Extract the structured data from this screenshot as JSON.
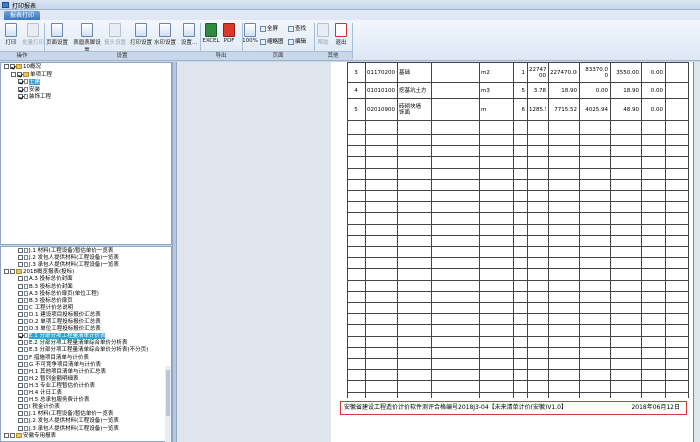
{
  "window": {
    "title": "打印报表"
  },
  "menu": {
    "tab": "报表打印"
  },
  "ribbon": {
    "buttons": [
      {
        "label": "打印",
        "icon": "printer-icon",
        "enabled": true
      },
      {
        "label": "批量打印",
        "icon": "batch-print-icon",
        "enabled": false
      },
      {
        "label": "页面设置",
        "icon": "page-setup-icon",
        "enabled": true
      },
      {
        "label": "表眉表脚设置",
        "icon": "header-footer-icon",
        "enabled": true
      },
      {
        "label": "报头设置",
        "icon": "report-header-icon",
        "enabled": false
      },
      {
        "label": "打印设置",
        "icon": "print-settings-icon",
        "enabled": true
      },
      {
        "label": "水印设置",
        "icon": "watermark-icon",
        "enabled": true
      },
      {
        "label": "设置...",
        "icon": "settings-icon",
        "enabled": true
      },
      {
        "label": "EXCEL",
        "icon": "excel-icon",
        "enabled": true
      },
      {
        "label": "PDF",
        "icon": "pdf-icon",
        "enabled": true
      },
      {
        "label": "100%",
        "icon": "zoom-icon",
        "enabled": true
      },
      {
        "label": "帮助",
        "icon": "help-icon",
        "enabled": false
      },
      {
        "label": "退出",
        "icon": "exit-icon",
        "enabled": true
      }
    ],
    "small": [
      {
        "label": "全屏",
        "icon": "fullscreen-icon"
      },
      {
        "label": "查找",
        "icon": "find-icon"
      },
      {
        "label": "缩略图",
        "icon": "thumbnail-icon"
      },
      {
        "label": "编辑",
        "icon": "edit-icon"
      }
    ],
    "groups": [
      "操作",
      "设置",
      "导出",
      "页面",
      "其他"
    ]
  },
  "tree_top": [
    {
      "label": "10概况",
      "level": 0,
      "checked": true,
      "icon": "folder"
    },
    {
      "label": "单项工程",
      "level": 1,
      "checked": true,
      "icon": "folder"
    },
    {
      "label": "土建",
      "level": 2,
      "checked": true,
      "icon": "doc",
      "selected": true
    },
    {
      "label": "安装",
      "level": 2,
      "checked": true,
      "icon": "doc"
    },
    {
      "label": "装饰工程",
      "level": 2,
      "checked": true,
      "icon": "doc"
    }
  ],
  "tree_bottom": [
    {
      "label": "J.1 材料(工程设备)暂估单价一览表",
      "level": 2
    },
    {
      "label": "J.2 发包人提供材料(工程设备)一览表",
      "level": 2
    },
    {
      "label": "J.3 承包人提供材料(工程设备)一览表",
      "level": 2
    },
    {
      "label": "2018概览报表(投标)",
      "level": 0,
      "folder": true
    },
    {
      "label": "A.3 投标总价封面",
      "level": 2
    },
    {
      "label": "B.3 投标总价封面",
      "level": 2
    },
    {
      "label": "A.3 投标总价扉页(单位工程)",
      "level": 2
    },
    {
      "label": "B.3 投标总价扉页",
      "level": 2
    },
    {
      "label": "C 工程计价总说明",
      "level": 2
    },
    {
      "label": "D.1 建设项目投标报价汇总表",
      "level": 2
    },
    {
      "label": "D.2 单项工程投标报价汇总表",
      "level": 2
    },
    {
      "label": "D.3 单位工程投标报价汇总表",
      "level": 2
    },
    {
      "label": "E.1 分部分项工程量清单计价表",
      "level": 2,
      "selected": true,
      "checked": true
    },
    {
      "label": "E.2 分部分项工程量清单综合单价分析表",
      "level": 2
    },
    {
      "label": "E.3 分部分项工程量清单综合单价分析表(不分页)",
      "level": 2
    },
    {
      "label": "F 措施项目清单与计价表",
      "level": 2
    },
    {
      "label": "G 不可竞争项目清单与计价表",
      "level": 2
    },
    {
      "label": "H.1 其他项目清单与计价汇总表",
      "level": 2
    },
    {
      "label": "H.2 暂列金额明细表",
      "level": 2
    },
    {
      "label": "H.3 专业工程暂估价计价表",
      "level": 2
    },
    {
      "label": "H.4 计日工表",
      "level": 2
    },
    {
      "label": "H.5 总承包服务费计价表",
      "level": 2
    },
    {
      "label": "I 税金计价表",
      "level": 2
    },
    {
      "label": "J.1 材料(工程设备)暂估单价一览表",
      "level": 2
    },
    {
      "label": "J.2 发包人提供材料(工程设备)一览表",
      "level": 2
    },
    {
      "label": "J.3 承包人提供材料(工程设备)一览表",
      "level": 2
    },
    {
      "label": "安徽专用报表",
      "level": 0,
      "folder": true
    }
  ],
  "table": {
    "rows": [
      {
        "no": "3",
        "code": "011702001001",
        "name": "基础",
        "feature": "",
        "unit": "m2",
        "qty": "1",
        "price": "227470.\n00",
        "total": "227470.00",
        "c1": "83370.0\n0",
        "c2": "3550.00",
        "c3": "0.00"
      },
      {
        "no": "4",
        "code": "010101004001",
        "name": "挖基坑土方",
        "feature": "",
        "unit": "m3",
        "qty": "5",
        "price": "3.78",
        "total": "18.90",
        "c1": "0.00",
        "c2": "18.90",
        "c3": "0.00"
      },
      {
        "no": "5",
        "code": "020109001001",
        "name": "砖砌块墙\n饰面",
        "feature": "",
        "unit": "m",
        "qty": "6",
        "price": "1285.92",
        "total": "7715.52",
        "c1": "4025.94",
        "c2": "48.90",
        "c3": "0.00"
      }
    ]
  },
  "footer": {
    "left": "安徽省建设工程造价计价软件测评合格编号2018J3-04【未来清单计价(安徽)V1.0】",
    "right": "2018年06月12日"
  }
}
